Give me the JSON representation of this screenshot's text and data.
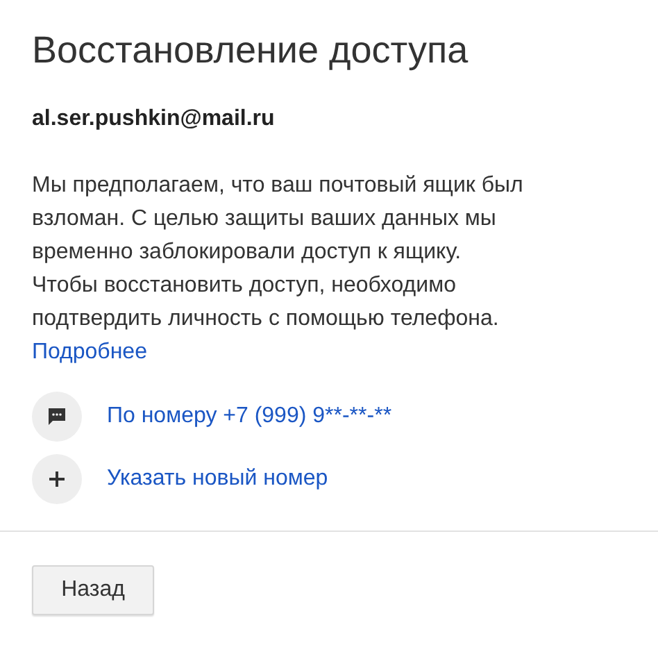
{
  "title": "Восстановление доступа",
  "email": "al.ser.pushkin@mail.ru",
  "message": "Мы предполагаем, что ваш почтовый ящик был\nвзломан. С целью защиты ваших данных мы\nвременно заблокировали доступ к ящику.\nЧтобы восстановить доступ, необходимо\nподтвердить личность с помощью телефона.",
  "more_link": "Подробнее",
  "options": [
    {
      "kind": "sms",
      "label": "По номеру +7 (999) 9**-**-**"
    },
    {
      "kind": "add",
      "label": "Указать новый номер"
    }
  ],
  "buttons": [
    "Назад"
  ]
}
